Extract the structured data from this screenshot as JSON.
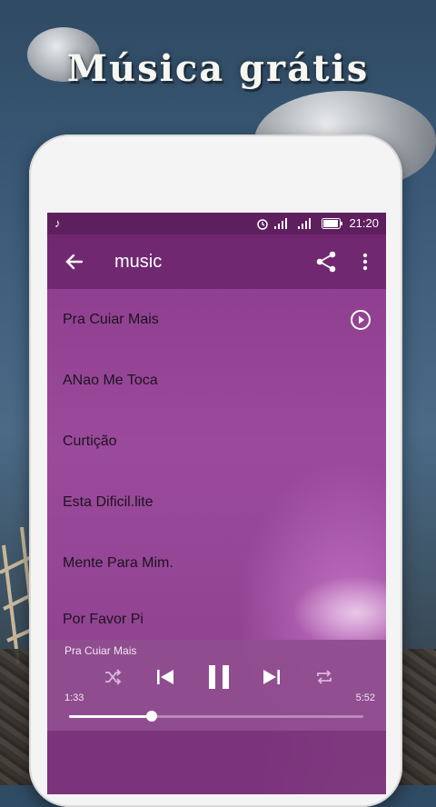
{
  "promo": {
    "title": "Música grátis"
  },
  "status_bar": {
    "time": "21:20"
  },
  "app_bar": {
    "title": "music"
  },
  "songs": [
    {
      "label": "Pra Cuiar Mais",
      "playing": true
    },
    {
      "label": "ANao Me Toca"
    },
    {
      "label": "Curtição"
    },
    {
      "label": "Esta Dificil.lite"
    },
    {
      "label": "Mente Para Mim."
    },
    {
      "label": "Por Favor Pi"
    }
  ],
  "player": {
    "now_playing": "Pra Cuiar Mais",
    "elapsed": "1:33",
    "duration": "5:52",
    "progress": 0.28
  },
  "colors": {
    "accent": "#7a2d7a",
    "status_bar": "#5e1f5e"
  },
  "icons": {
    "back": "arrow-left-icon",
    "share": "share-icon",
    "more": "more-vert-icon",
    "play": "play-circle-icon",
    "shuffle": "shuffle-icon",
    "prev": "skip-previous-icon",
    "pause": "pause-icon",
    "next": "skip-next-icon",
    "repeat": "repeat-icon"
  }
}
